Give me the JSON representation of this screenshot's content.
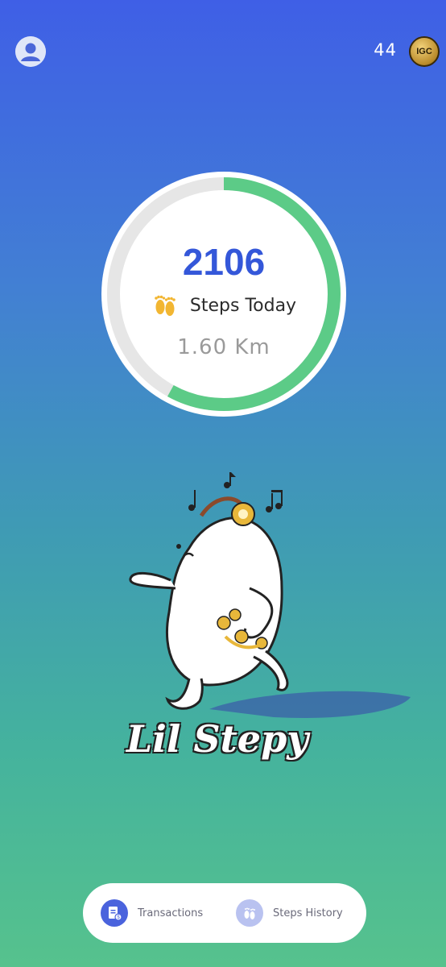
{
  "header": {
    "coin_count": "44",
    "coin_icon_label": "IGC"
  },
  "progress": {
    "steps": "2106",
    "steps_label": "Steps Today",
    "distance": "1.60 Km",
    "fraction": 0.58,
    "ring_color": "#5ccb87",
    "track_color": "#e6e6e6"
  },
  "mascot": {
    "title": "Lil Stepy"
  },
  "bottom_nav": {
    "items": [
      {
        "label": "Transactions",
        "icon": "receipt-dollar-icon"
      },
      {
        "label": "Steps History",
        "icon": "footprints-icon"
      }
    ]
  },
  "colors": {
    "accent": "#3457d9",
    "gradient_top": "#3f5fe6",
    "gradient_bottom": "#56c28d"
  }
}
